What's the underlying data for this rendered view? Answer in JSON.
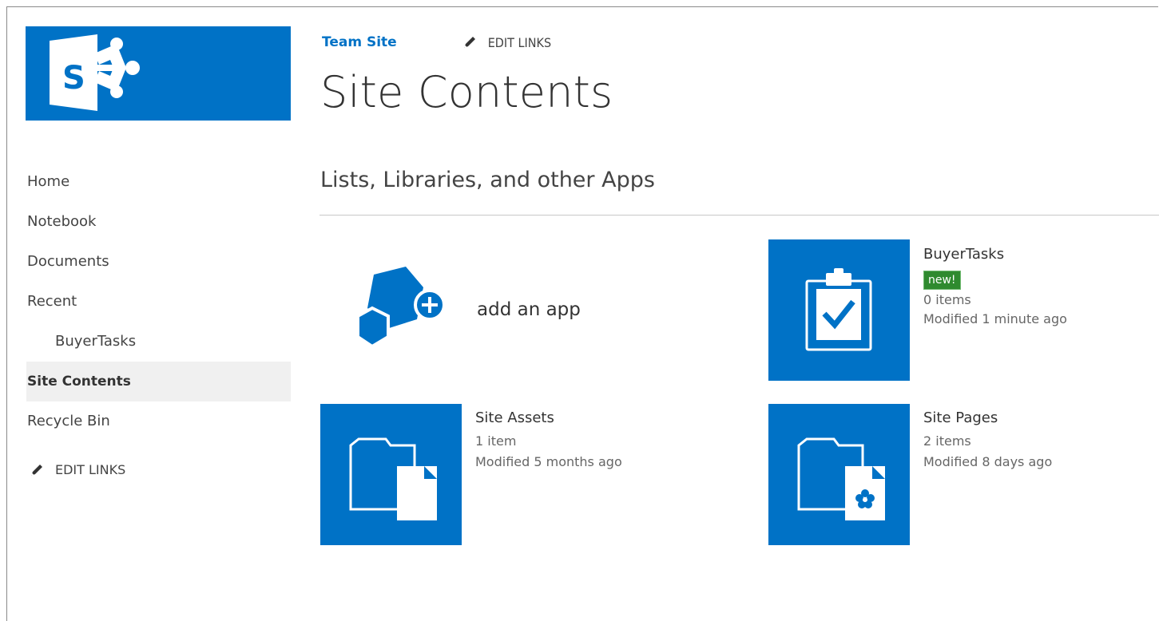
{
  "header": {
    "site_title": "Team Site",
    "edit_links": "EDIT LINKS",
    "page_title": "Site Contents"
  },
  "quick_launch": {
    "items": [
      {
        "label": "Home"
      },
      {
        "label": "Notebook"
      },
      {
        "label": "Documents"
      },
      {
        "label": "Recent"
      },
      {
        "label": "BuyerTasks"
      },
      {
        "label": "Site Contents"
      },
      {
        "label": "Recycle Bin"
      }
    ],
    "edit_links": "EDIT LINKS"
  },
  "main": {
    "section_title": "Lists, Libraries, and other Apps",
    "add_app_label": "add an app",
    "apps": [
      {
        "name": "BuyerTasks",
        "badge": "new!",
        "count": "0 items",
        "modified": "Modified 1 minute ago",
        "icon": "clipboard-check-icon"
      },
      {
        "name": "Site Assets",
        "count": "1 item",
        "modified": "Modified 5 months ago",
        "icon": "folder-document-icon"
      },
      {
        "name": "Site Pages",
        "count": "2 items",
        "modified": "Modified 8 days ago",
        "icon": "folder-page-icon"
      }
    ]
  },
  "colors": {
    "brand_blue": "#0072c6",
    "badge_green": "#2f8a2f",
    "selected_bg": "#f0f0f0"
  }
}
